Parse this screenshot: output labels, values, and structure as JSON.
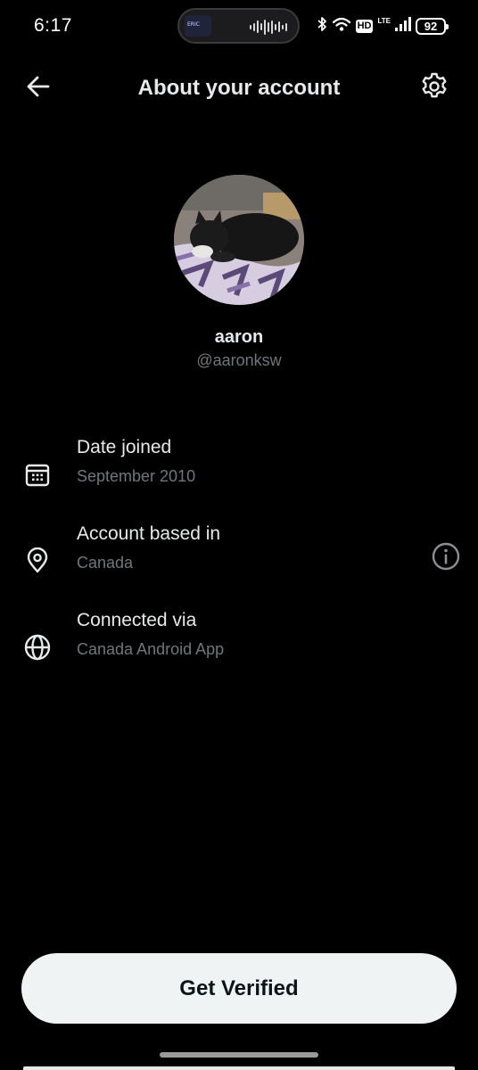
{
  "status_bar": {
    "time": "6:17",
    "island_art_text": "ERIC",
    "hd": "HD",
    "network": "LTE",
    "battery": "92"
  },
  "header": {
    "title": "About your account",
    "back_icon": "arrow-left-icon",
    "settings_icon": "gear-icon"
  },
  "profile": {
    "name": "aaron",
    "handle": "@aaronksw"
  },
  "info": [
    {
      "title": "Date joined",
      "value": "September 2010",
      "icon": "calendar-icon"
    },
    {
      "title": "Account based in",
      "value": "Canada",
      "icon": "location-pin-icon",
      "help_icon": "info-icon"
    },
    {
      "title": "Connected via",
      "value": "Canada Android App",
      "icon": "globe-icon"
    }
  ],
  "actions": {
    "verify_label": "Get Verified"
  },
  "colors": {
    "background": "#000000",
    "primary_text": "#e7e9ea",
    "secondary_text": "#71767b",
    "button_bg": "#eff3f4",
    "button_text": "#0f1419"
  }
}
